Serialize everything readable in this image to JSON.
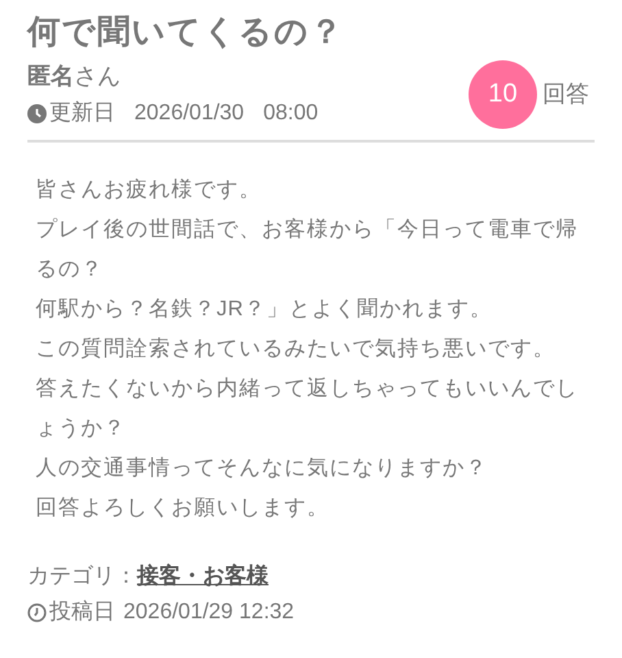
{
  "title": "何で聞いてくるの？",
  "author": "**匿名**さん",
  "updated": {
    "label": "更新日",
    "date": "2026/01/30",
    "time": "08:00"
  },
  "answers": {
    "count": "10",
    "label": "回答"
  },
  "body": [
    "皆さんお疲れ様です。",
    "プレイ後の世間話で、お客様から「今日って電車で帰るの？",
    "何駅から？名鉄？JR？」とよく聞かれます。",
    "この質問詮索されているみたいで気持ち悪いです。",
    "答えたくないから内緒って返しちゃってもいいんでしょうか？",
    "人の交通事情ってそんなに気になりますか？",
    "回答よろしくお願いします。"
  ],
  "category": {
    "label": "カテゴリ：",
    "value": "接客・お客様"
  },
  "posted": {
    "label": "投稿日",
    "datetime": "2026/01/29 12:32"
  }
}
